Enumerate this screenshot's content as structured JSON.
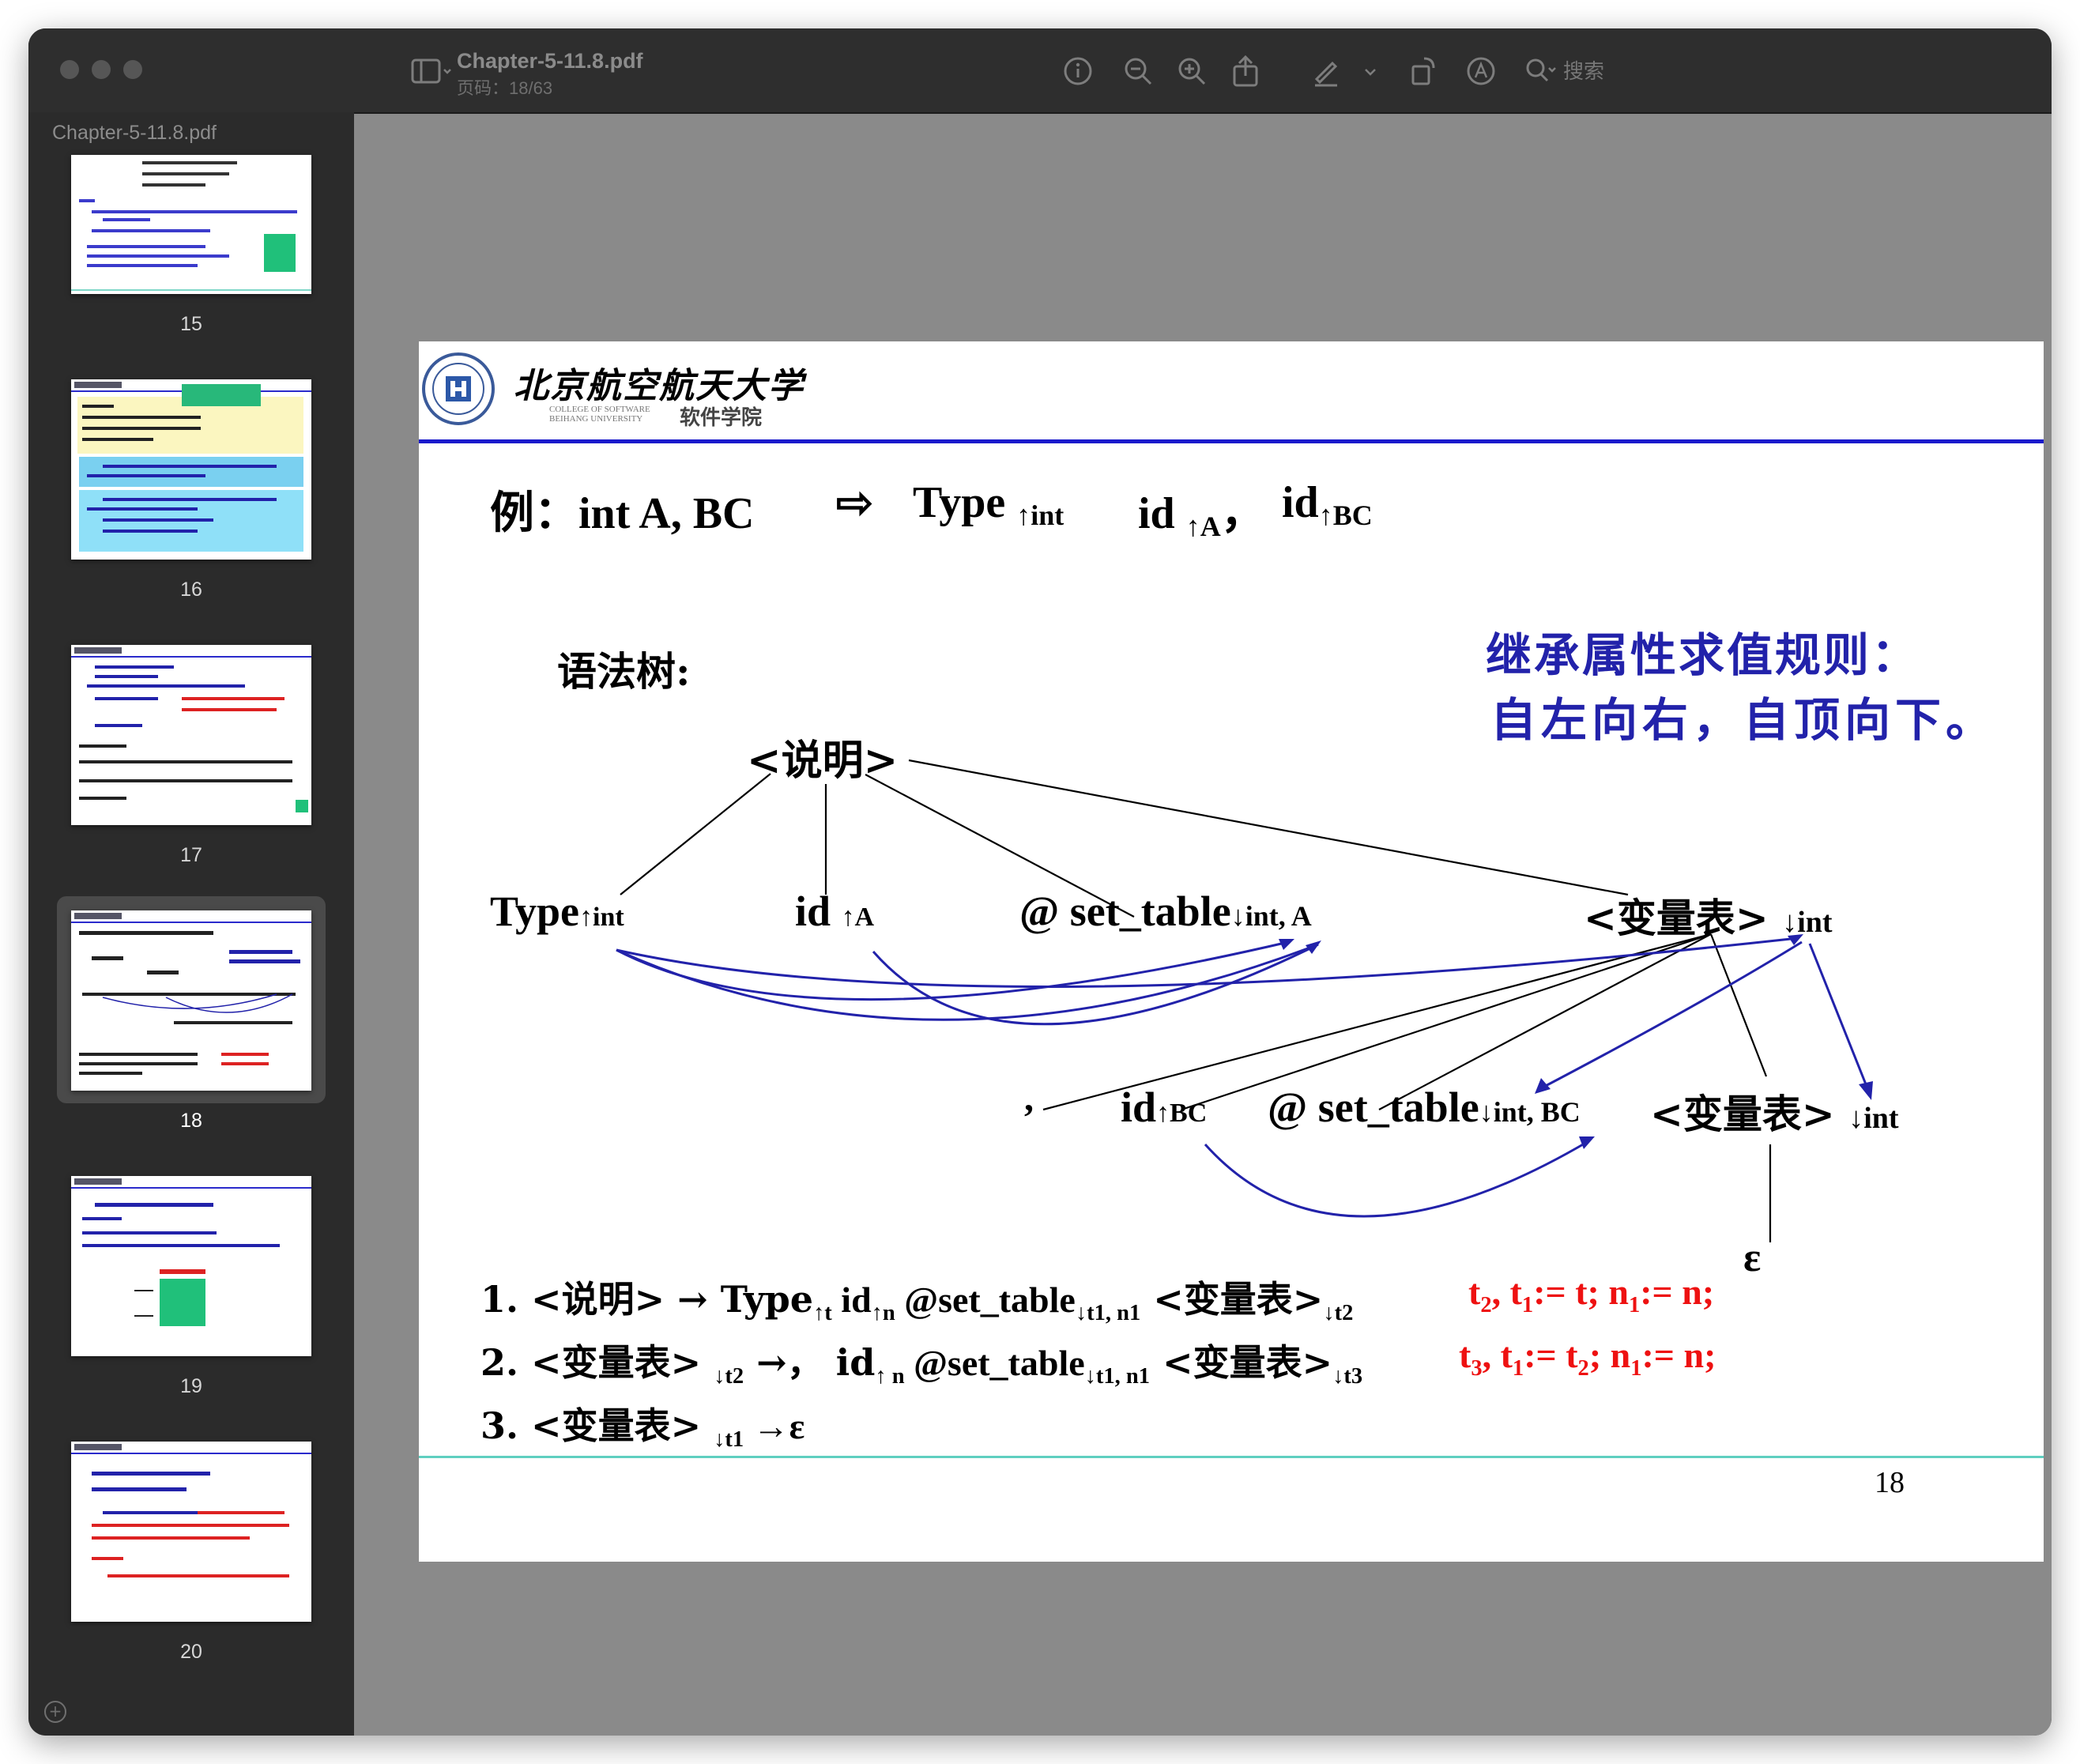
{
  "window": {
    "sidebar_title": "Chapter-5-11.8.pdf",
    "doc_name": "Chapter-5-11.8.pdf",
    "page_label": "页码：18/63",
    "search_placeholder": "搜索"
  },
  "toolbar": {
    "icons": [
      "sidebar-toggle-icon",
      "info-icon",
      "zoom-out-icon",
      "zoom-in-icon",
      "share-icon",
      "markup-pen-icon",
      "chevron-down-icon",
      "rotate-icon",
      "annotate-icon",
      "search-icon"
    ]
  },
  "thumbnails": [
    {
      "page": "15"
    },
    {
      "page": "16"
    },
    {
      "page": "17"
    },
    {
      "page": "18",
      "selected": true
    },
    {
      "page": "19"
    },
    {
      "page": "20"
    }
  ],
  "slide": {
    "logo_cn": "北京航空航天大学",
    "logo_en": "COLLEGE OF SOFTWARE BEIHANG UNIVERSITY",
    "logo_dept": "软件学院",
    "example_prefix": "例：",
    "example_text": "int  A, BC",
    "arrow": "⇨",
    "type_label": "Type",
    "type_sub": "↑int",
    "id_a": "id",
    "id_a_sub": "↑A",
    "comma": "，",
    "id_bc": "id",
    "id_bc_sub": "↑BC",
    "rule_title_1": "继承属性求值规则：",
    "rule_title_2": "自左向右，自顶向下。",
    "tree_label": "语法树:",
    "nodes": {
      "root": "<说明>",
      "type": "Type",
      "type_sub": "↑int",
      "id": "id ",
      "id_sub": "↑A",
      "set_table": "@ set_table",
      "set_table_sub": "↓int, A",
      "varlist": "<变量表> ",
      "varlist_sub": "↓int",
      "comma": ",",
      "id2": "id",
      "id2_sub": "↑BC",
      "set_table2": "@ set_table",
      "set_table2_sub": "↓int, BC",
      "varlist2": "<变量表> ",
      "varlist2_sub": "↓int",
      "epsilon": "ε"
    },
    "rules": [
      {
        "lhs": "1. <说明> → Type",
        "parts": [
          "↑t",
          " id",
          "↑n",
          " @set_table",
          "↓t1, n1",
          " <变量表>",
          "↓t2"
        ],
        "action": [
          "t",
          "2",
          ", t",
          "1",
          ":= t;   n",
          "1",
          ":= n;"
        ]
      },
      {
        "lhs": "2. <变量表> ",
        "parts": [
          "↓t2",
          " →，  id",
          "↑ n",
          " @set_table",
          "↓t1, n1",
          " <变量表>",
          "↓t3"
        ],
        "action": [
          "t",
          "3",
          ", t",
          "1",
          ":= t",
          "2",
          ";  n",
          "1",
          ":= n;"
        ]
      },
      {
        "lhs": "3. <变量表> ",
        "parts": [
          "↓t1",
          " →ε"
        ]
      }
    ],
    "page_number": "18"
  },
  "colors": {
    "accent_blue": "#2222aa",
    "rule_red": "#ee1111",
    "header_rule": "#1a1acc",
    "footer_rule": "#5fcfc0"
  }
}
